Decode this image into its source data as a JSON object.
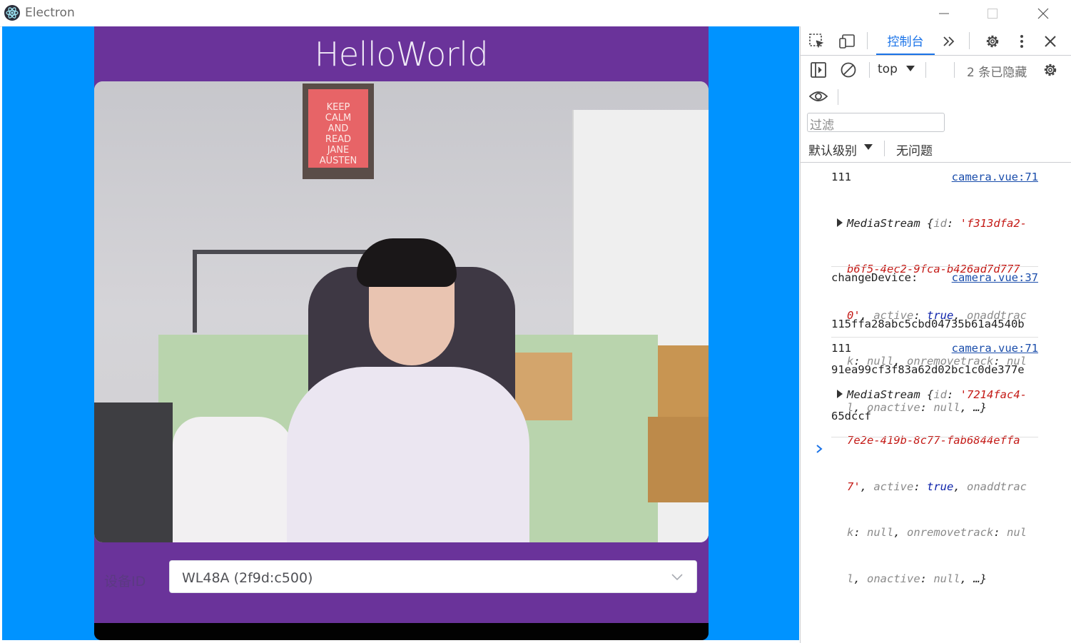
{
  "window": {
    "title": "Electron",
    "controls": [
      "minimize-icon",
      "maximize-icon",
      "close-icon"
    ]
  },
  "app": {
    "heading": "HelloWorld",
    "device_label": "设备ID",
    "device_select": {
      "value": "WL48A (2f9d:c500)"
    },
    "camera_poster_text": "KEEP\nCALM\nAND\nREAD\nJANE\nAUSTEN",
    "colors": {
      "background": "#0093ff",
      "panel": "#6a339a"
    }
  },
  "devtools": {
    "tab_active": "控制台",
    "context": "top",
    "hidden_count": "2 条已隐藏",
    "filter_placeholder": "过滤",
    "default_levels": "默认级别",
    "no_issues": "无问题",
    "messages": [
      {
        "label": "111",
        "source": "camera.vue:71",
        "lines": [
          [
            "MediaStream {",
            "id",
            ": ",
            "'f313dfa2-"
          ],
          [
            "b6f5-4ec2-9fca-b426ad7d777"
          ],
          [
            "0'",
            ", ",
            "active",
            ": ",
            "true",
            ", ",
            "onaddtrac"
          ],
          [
            "k",
            ": ",
            "null",
            ", ",
            "onremovetrack",
            ": ",
            "nul"
          ],
          [
            "l",
            ", ",
            "onactive",
            ": ",
            "null",
            ", …}"
          ]
        ]
      },
      {
        "label": "changeDevice:",
        "source": "camera.vue:37",
        "lines": [
          "115ffa28abc5cbd04735b61a4540b",
          "91ea99cf3f83a62d02bc1c0de377e",
          "65dccf"
        ]
      },
      {
        "label": "111",
        "source": "camera.vue:71",
        "lines": [
          [
            "MediaStream {",
            "id",
            ": ",
            "'7214fac4-"
          ],
          [
            "7e2e-419b-8c77-fab6844effa"
          ],
          [
            "7'",
            ", ",
            "active",
            ": ",
            "true",
            ", ",
            "onaddtrac"
          ],
          [
            "k",
            ": ",
            "null",
            ", ",
            "onremovetrack",
            ": ",
            "nul"
          ],
          [
            "l",
            ", ",
            "onactive",
            ": ",
            "null",
            ", …}"
          ]
        ]
      }
    ]
  }
}
